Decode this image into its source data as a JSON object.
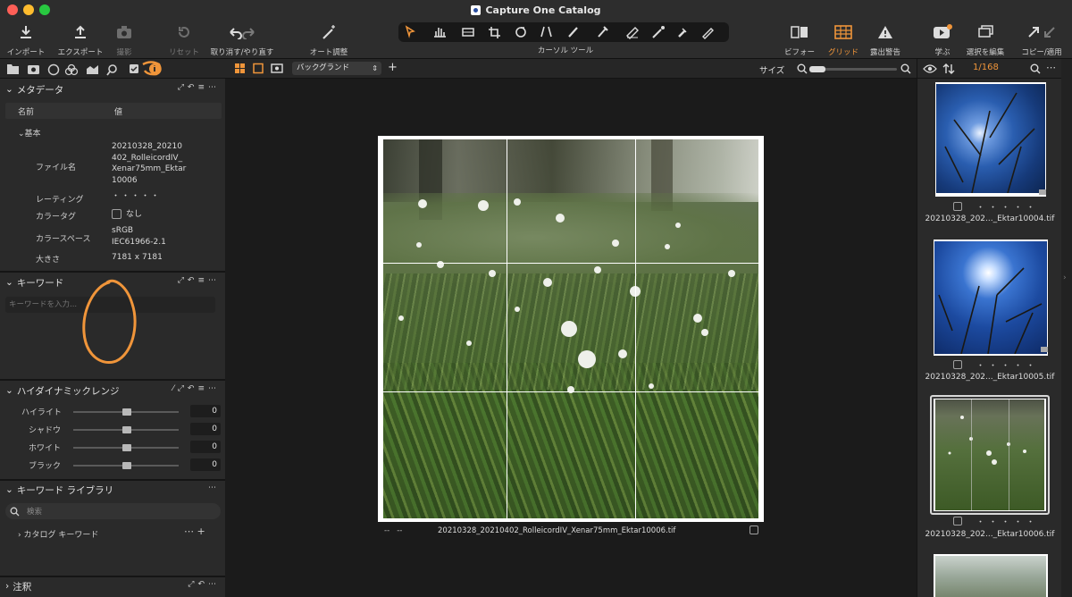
{
  "window": {
    "title": "Capture One Catalog"
  },
  "toolbar": {
    "import": "インポート",
    "export": "エクスポート",
    "capture": "撮影",
    "reset": "リセット",
    "undo_redo": "取り消す/やり直す",
    "auto_adjust": "オート調整",
    "cursor_tools": "カーソル ツール",
    "before": "ビフォー",
    "grid": "グリッド",
    "exposure_warning": "露出警告",
    "learn": "学ぶ",
    "edit_selection": "選択を編集",
    "copy_apply": "コピー/適用"
  },
  "metadata": {
    "title": "メタデータ",
    "col_name": "名前",
    "col_value": "値",
    "group_basic": "基本",
    "filename_label": "ファイル名",
    "filename_lines": [
      "20210328_20210",
      "402_RolleicordIV_",
      "Xenar75mm_Ektar",
      "10006"
    ],
    "rating_label": "レーティング",
    "rating_value": "・・・・・",
    "color_tag_label": "カラータグ",
    "color_tag_value": "なし",
    "color_space_label": "カラースペース",
    "color_space_lines": [
      "sRGB",
      "IEC61966-2.1"
    ],
    "size_label": "大きさ",
    "size_value": "7181 x 7181"
  },
  "keywords": {
    "title": "キーワード",
    "placeholder": "キーワードを入力..."
  },
  "hdr": {
    "title": "ハイダイナミックレンジ",
    "sliders": [
      {
        "label": "ハイライト",
        "value": "0"
      },
      {
        "label": "シャドウ",
        "value": "0"
      },
      {
        "label": "ホワイト",
        "value": "0"
      },
      {
        "label": "ブラック",
        "value": "0"
      }
    ]
  },
  "keyword_library": {
    "title": "キーワード ライブラリ",
    "search_placeholder": "検索",
    "catalog_keywords": "カタログ キーワード"
  },
  "annotations": {
    "title": "注釈"
  },
  "viewer": {
    "background_select": "バックグランド",
    "size_label": "サイズ",
    "caption_left": "--   --",
    "filename": "20210328_20210402_RolleicordIV_Xenar75mm_Ektar10006.tif"
  },
  "browser": {
    "counter": "1/168",
    "thumbs": [
      {
        "name": "20210328_202..._Ektar10004.tif",
        "rating": "・・・・・"
      },
      {
        "name": "20210328_202..._Ektar10005.tif",
        "rating": "・・・・・"
      },
      {
        "name": "20210328_202..._Ektar10006.tif",
        "rating": "・・・・・"
      }
    ]
  },
  "colors": {
    "accent": "#f0953a",
    "panel": "#2a2a2a",
    "viewer": "#1b1b1b"
  }
}
